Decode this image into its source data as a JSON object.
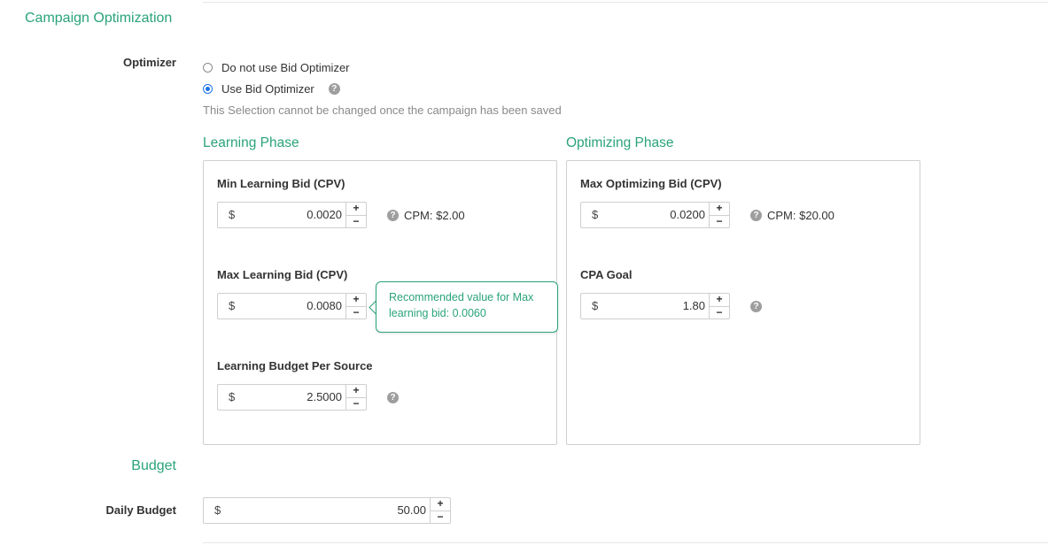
{
  "section_title": "Campaign Optimization",
  "optimizer": {
    "label": "Optimizer",
    "options": [
      {
        "label": "Do not use Bid Optimizer",
        "selected": false
      },
      {
        "label": "Use Bid Optimizer",
        "selected": true
      }
    ],
    "note": "This Selection cannot be changed once the campaign has been saved"
  },
  "learning_phase": {
    "title": "Learning Phase",
    "min_bid": {
      "label": "Min Learning Bid (CPV)",
      "currency": "$",
      "value": "0.0020",
      "cpm": "CPM: $2.00"
    },
    "max_bid": {
      "label": "Max Learning Bid (CPV)",
      "currency": "$",
      "value": "0.0080"
    },
    "budget": {
      "label": "Learning Budget Per Source",
      "currency": "$",
      "value": "2.5000"
    },
    "tooltip": "Recommended value for Max learning bid: 0.0060"
  },
  "optimizing_phase": {
    "title": "Optimizing Phase",
    "max_bid": {
      "label": "Max Optimizing Bid (CPV)",
      "currency": "$",
      "value": "0.0200",
      "cpm": "CPM: $20.00"
    },
    "cpa_goal": {
      "label": "CPA Goal",
      "currency": "$",
      "value": "1.80"
    }
  },
  "budget": {
    "title": "Budget",
    "daily": {
      "label": "Daily Budget",
      "currency": "$",
      "value": "50.00"
    }
  },
  "stepper": {
    "plus": "+",
    "minus": "−"
  },
  "icons": {
    "help": "?"
  },
  "colors": {
    "accent": "#2aa37a",
    "radio_selected": "#1a73e8"
  }
}
